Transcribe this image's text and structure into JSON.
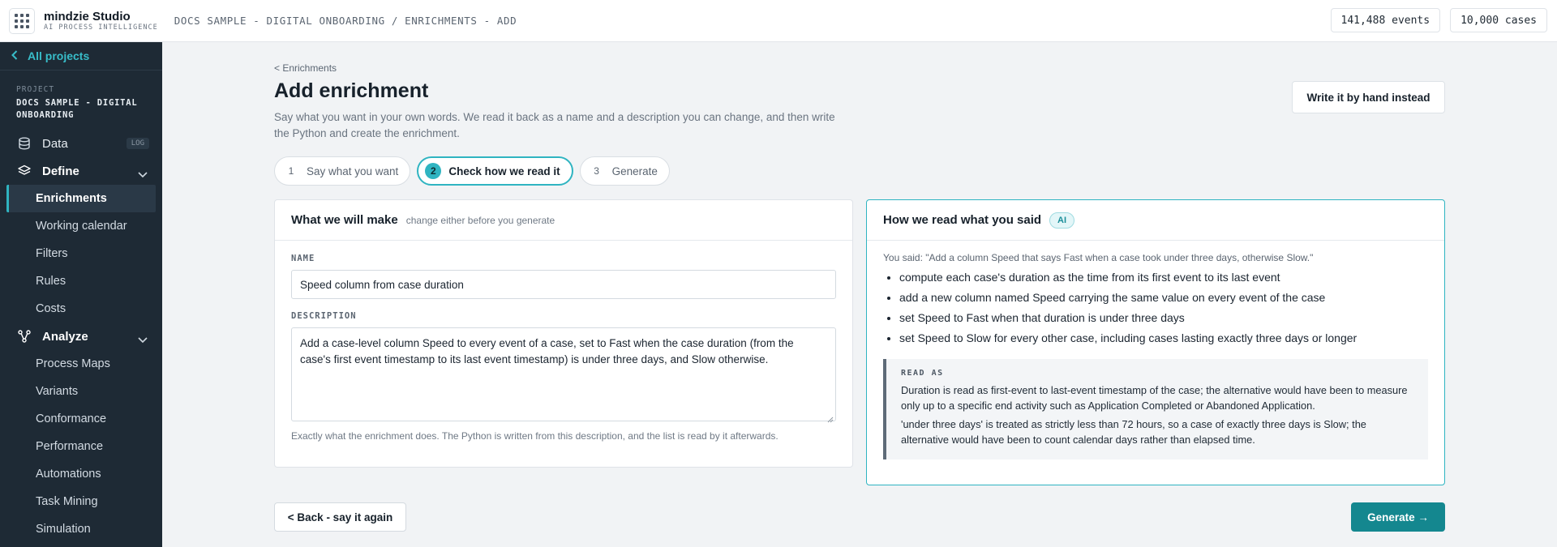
{
  "app": {
    "name": "mindzie Studio",
    "tagline": "AI PROCESS INTELLIGENCE"
  },
  "topbar": {
    "breadcrumb": "DOCS SAMPLE - DIGITAL ONBOARDING / ENRICHMENTS - ADD",
    "events": "141,488 events",
    "cases": "10,000 cases"
  },
  "sidebar": {
    "all_projects": "All projects",
    "project_label": "PROJECT",
    "project_name": "DOCS SAMPLE - DIGITAL ONBOARDING",
    "data": {
      "label": "Data",
      "badge": "LOG"
    },
    "define": {
      "label": "Define",
      "items": [
        "Enrichments",
        "Working calendar",
        "Filters",
        "Rules",
        "Costs"
      ]
    },
    "analyze": {
      "label": "Analyze",
      "items": [
        "Process Maps",
        "Variants",
        "Conformance",
        "Performance",
        "Automations",
        "Task Mining",
        "Simulation"
      ]
    }
  },
  "page": {
    "back_link": "< Enrichments",
    "title": "Add enrichment",
    "subtitle": "Say what you want in your own words. We read it back as a name and a description you can change, and then write the Python and create the enrichment.",
    "hand_button": "Write it by hand instead"
  },
  "steps": [
    {
      "num": "1",
      "label": "Say what you want"
    },
    {
      "num": "2",
      "label": "Check how we read it"
    },
    {
      "num": "3",
      "label": "Generate"
    }
  ],
  "make_card": {
    "title": "What we will make",
    "hint": "change either before you generate",
    "name_label": "NAME",
    "name_value": "Speed column from case duration",
    "desc_label": "DESCRIPTION",
    "desc_value": "Add a case-level column Speed to every event of a case, set to Fast when the case duration (from the case's first event timestamp to its last event timestamp) is under three days, and Slow otherwise.",
    "help": "Exactly what the enrichment does. The Python is written from this description, and the list is read by it afterwards."
  },
  "read_card": {
    "title": "How we read what you said",
    "badge": "AI",
    "you_said": "You said: \"Add a column Speed that says Fast when a case took under three days, otherwise Slow.\"",
    "bullets": [
      "compute each case's duration as the time from its first event to its last event",
      "add a new column named Speed carrying the same value on every event of the case",
      "set Speed to Fast when that duration is under three days",
      "set Speed to Slow for every other case, including cases lasting exactly three days or longer"
    ],
    "read_as_label": "READ AS",
    "read_as_1": "Duration is read as first-event to last-event timestamp of the case; the alternative would have been to measure only up to a specific end activity such as Application Completed or Abandoned Application.",
    "read_as_2": "'under three days' is treated as strictly less than 72 hours, so a case of exactly three days is Slow; the alternative would have been to count calendar days rather than elapsed time."
  },
  "footer": {
    "back_button": "< Back - say it again",
    "generate_button": "Generate →"
  },
  "colors": {
    "accent": "#2fb4c1",
    "primary_button": "#14878f",
    "sidebar_bg": "#1e2a35"
  }
}
